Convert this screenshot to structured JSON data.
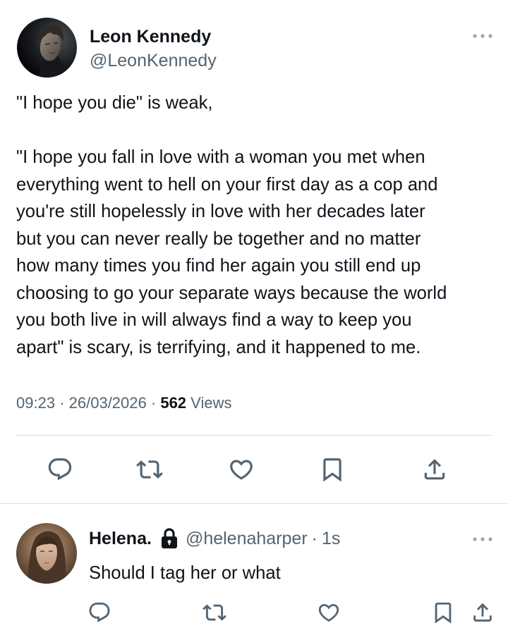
{
  "main_tweet": {
    "author_name": "Leon Kennedy",
    "author_handle": "@LeonKennedy",
    "text_lines": [
      "\"I hope you die\" is weak,",
      "",
      "\"I hope you fall in love with a woman you met when",
      "everything went to hell on your first day as a cop and",
      "you're still hopelessly in love with her decades later",
      "but you can never really be together and no matter",
      "how many times you find her again you still end up",
      "choosing to go your separate ways because the world",
      "you both live in will always find a way to keep you",
      "apart\" is scary, is terrifying, and it happened to me."
    ],
    "time": "09:23",
    "date": "26/03/2026",
    "separator": "·",
    "views_count": "562",
    "views_label": "Views",
    "more_icon": "more-horizontal-icon",
    "actions": [
      "reply-icon",
      "retweet-icon",
      "like-icon",
      "bookmark-icon",
      "share-icon"
    ]
  },
  "reply": {
    "author_name": "Helena.",
    "author_handle": "@helenaharper",
    "separator": "·",
    "time_ago": "1s",
    "text": "Should I tag her or what",
    "protected_icon": "lock-icon",
    "more_icon": "more-horizontal-icon",
    "actions": [
      "reply-icon",
      "retweet-icon",
      "like-icon",
      "bookmark-icon",
      "share-icon"
    ]
  },
  "colors": {
    "text_primary": "#0f1419",
    "text_secondary": "#536471",
    "divider": "#cfd9de",
    "background": "#ffffff"
  }
}
